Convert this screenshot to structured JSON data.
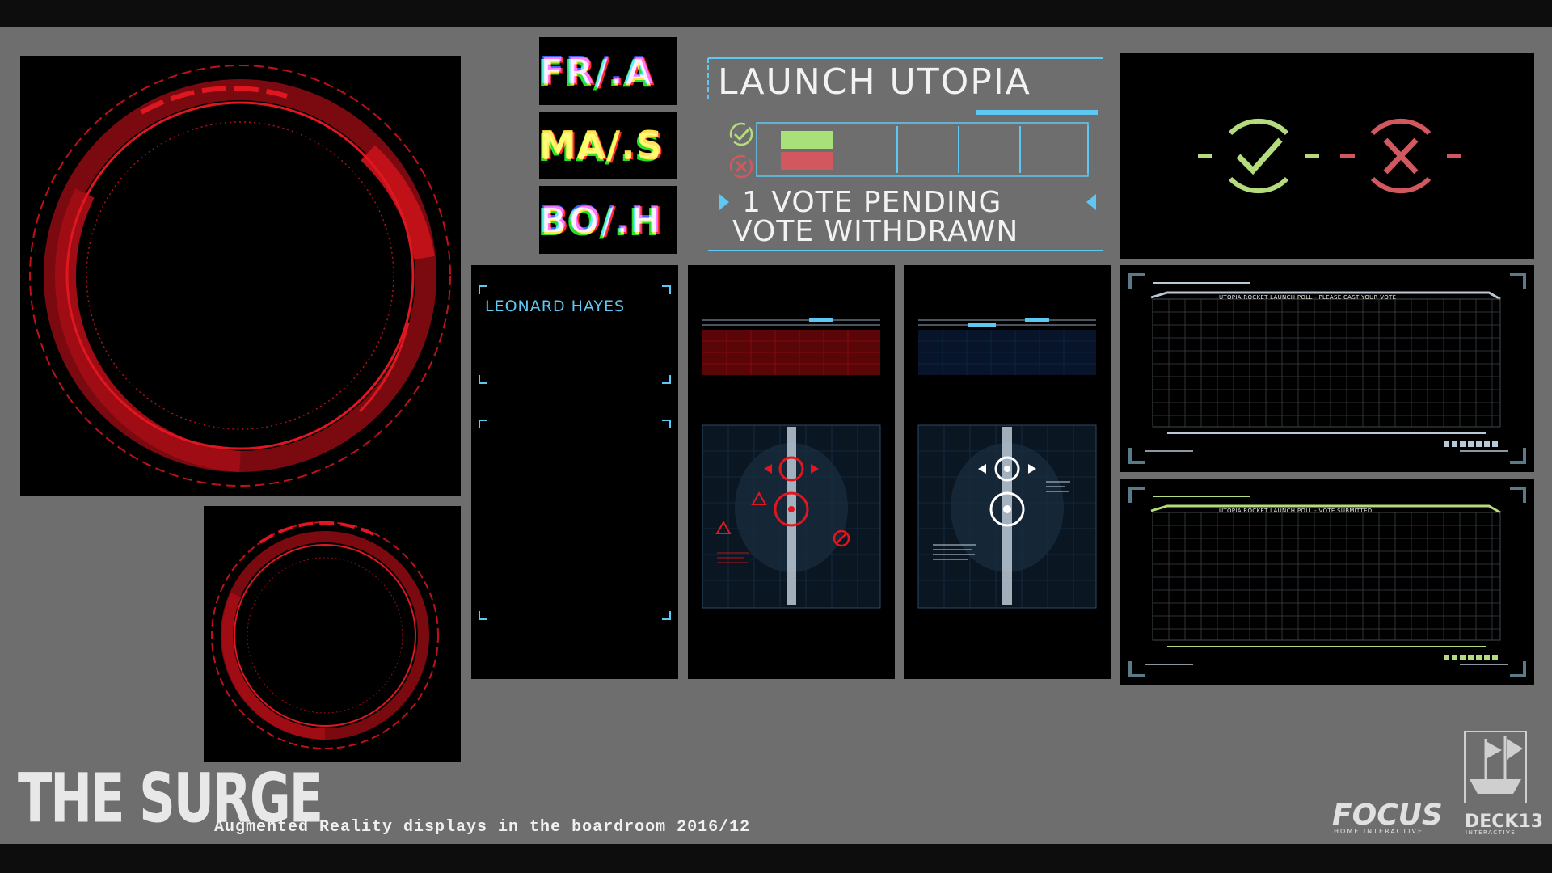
{
  "glitch_labels": [
    "FR/.A",
    "MA/.S",
    "BO/.H"
  ],
  "launch": {
    "title": "LAUNCH UTOPIA",
    "status_pending": "1 VOTE PENDING",
    "status_withdrawn": "VOTE WITHDRAWN"
  },
  "profile": {
    "name": "LEONARD HAYES"
  },
  "polls": [
    {
      "title": "UTOPIA ROCKET LAUNCH POLL - PLEASE CAST YOUR VOTE"
    },
    {
      "title": "UTOPIA ROCKET LAUNCH POLL - VOTE SUBMITTED"
    }
  ],
  "footer": {
    "logo_text": "THE SURGE",
    "caption": "Augmented Reality displays in the boardroom 2016/12",
    "publisher": "FOCUS",
    "publisher_sub": "HOME INTERACTIVE",
    "studio": "DECK13",
    "studio_sub": "INTERACTIVE"
  },
  "colors": {
    "background": "#6e6e6e",
    "hud_red": "#d0101a",
    "hud_blue": "#5ec8f2",
    "vote_yes": "#b4dc7c",
    "vote_no": "#d0585e"
  },
  "icons": {
    "approve": "check-circle-icon",
    "reject": "x-circle-icon"
  }
}
